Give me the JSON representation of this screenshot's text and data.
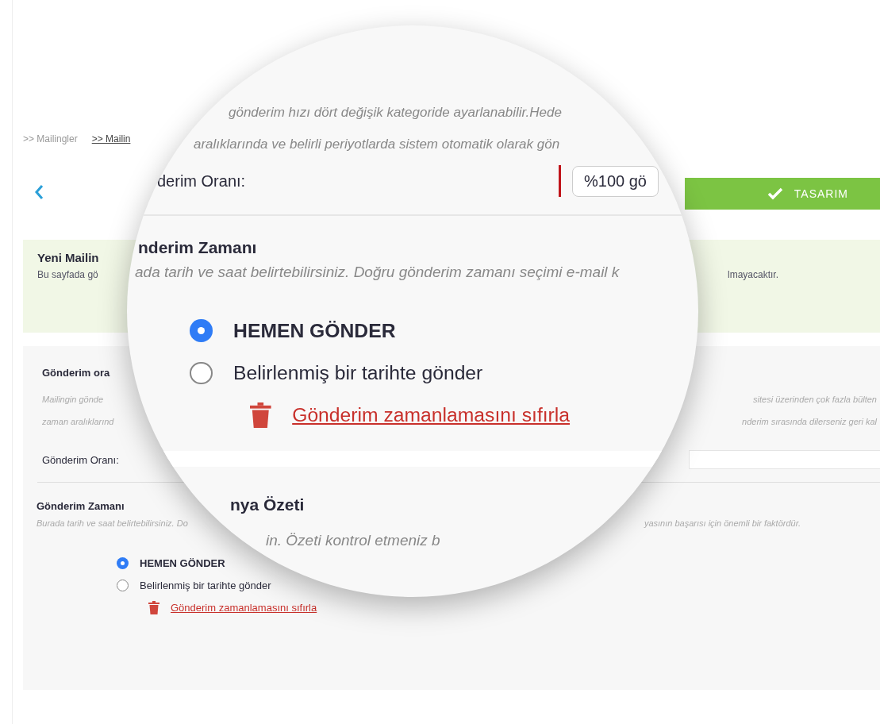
{
  "breadcrumbs": [
    {
      "label": ">> Mailingler",
      "current": false
    },
    {
      "label": ">> Mailin",
      "current": true
    }
  ],
  "step_button": {
    "label": "TASARIM"
  },
  "notice": {
    "title": "Yeni Mailin",
    "text_start": "Bu sayfada gö",
    "text_end": "lmayacaktır."
  },
  "settings": {
    "rate": {
      "title": "Gönderim ora",
      "desc_left": [
        "Mailingin gönde",
        "zaman aralıklarınd"
      ],
      "desc_right": [
        "sitesi üzerinden çok fazla bülten",
        "nderim sırasında dilerseniz geri kal"
      ],
      "label": "Gönderim Oranı:"
    },
    "time": {
      "title": "Gönderim Zamanı",
      "desc_left": "Burada tarih ve saat belirtebilirsiniz. Do",
      "desc_right": "yasının başarısı için önemli bir faktördür.",
      "options": [
        {
          "label": "HEMEN GÖNDER",
          "selected": true
        },
        {
          "label": "Belirlenmiş bir tarihte gönder",
          "selected": false
        }
      ],
      "reset_link": "Gönderim zamanlamasını sıfırla"
    }
  },
  "magnifier": {
    "rate_desc": [
      "gönderim hızı dört değişik kategoride ayarlanabilir.Hede",
      "aralıklarında ve belirli periyotlarda sistem otomatik olarak gön"
    ],
    "rate_label": "derim Oranı:",
    "rate_value": "%100 gö",
    "time_title": "nderim Zamanı",
    "time_desc": "ada tarih ve saat belirtebilirsiniz. Doğru gönderim zamanı seçimi e-mail k",
    "options": [
      {
        "label": "HEMEN GÖNDER",
        "selected": true
      },
      {
        "label": "Belirlenmiş bir tarihte gönder",
        "selected": false
      }
    ],
    "reset_link": "Gönderim zamanlamasını sıfırla",
    "summary_title": "nya Özeti",
    "summary_desc": "in. Özeti kontrol etmeniz b"
  }
}
